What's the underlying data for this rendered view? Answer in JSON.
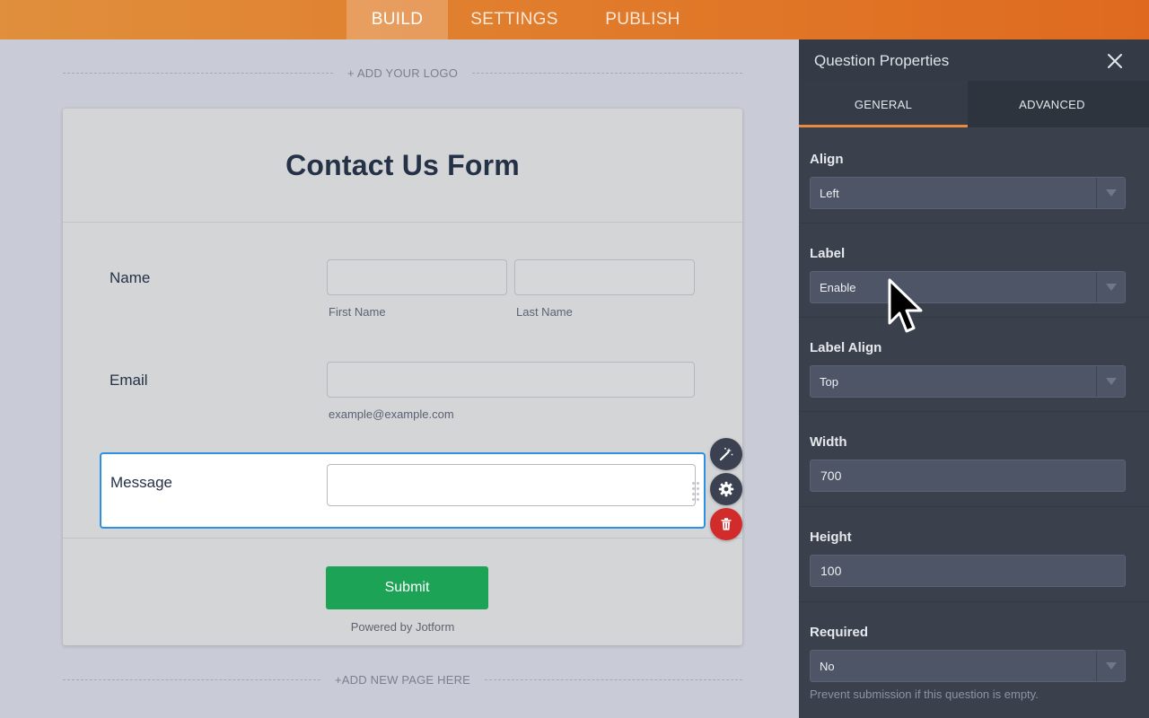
{
  "topbar": {
    "tabs": [
      {
        "label": "BUILD",
        "active": true
      },
      {
        "label": "SETTINGS",
        "active": false
      },
      {
        "label": "PUBLISH",
        "active": false
      }
    ]
  },
  "canvas": {
    "add_logo": "+ ADD YOUR LOGO",
    "add_page": "+ADD NEW PAGE HERE"
  },
  "form": {
    "title": "Contact Us Form",
    "fields": {
      "name": {
        "label": "Name",
        "first_sublabel": "First Name",
        "last_sublabel": "Last Name"
      },
      "email": {
        "label": "Email",
        "sublabel": "example@example.com"
      },
      "message": {
        "label": "Message"
      }
    },
    "submit_label": "Submit",
    "powered_by": "Powered by Jotform"
  },
  "field_tools": [
    "magic-wand-icon",
    "gear-icon",
    "trash-icon"
  ],
  "panel": {
    "title": "Question Properties",
    "tabs": [
      {
        "label": "GENERAL",
        "active": true
      },
      {
        "label": "ADVANCED",
        "active": false
      }
    ],
    "properties": {
      "align": {
        "label": "Align",
        "value": "Left"
      },
      "label": {
        "label": "Label",
        "value": "Enable"
      },
      "label_align": {
        "label": "Label Align",
        "value": "Top"
      },
      "width": {
        "label": "Width",
        "value": "700"
      },
      "height": {
        "label": "Height",
        "value": "100"
      },
      "required": {
        "label": "Required",
        "value": "No",
        "hint": "Prevent submission if this question is empty."
      }
    }
  },
  "colors": {
    "topbar_orange": "#e07a2a",
    "tab_active_underline": "#e98b3a",
    "selected_field_border": "#2e90e0",
    "submit_green": "#1da355",
    "delete_red": "#d12b2b",
    "panel_bg": "#3a404c"
  }
}
